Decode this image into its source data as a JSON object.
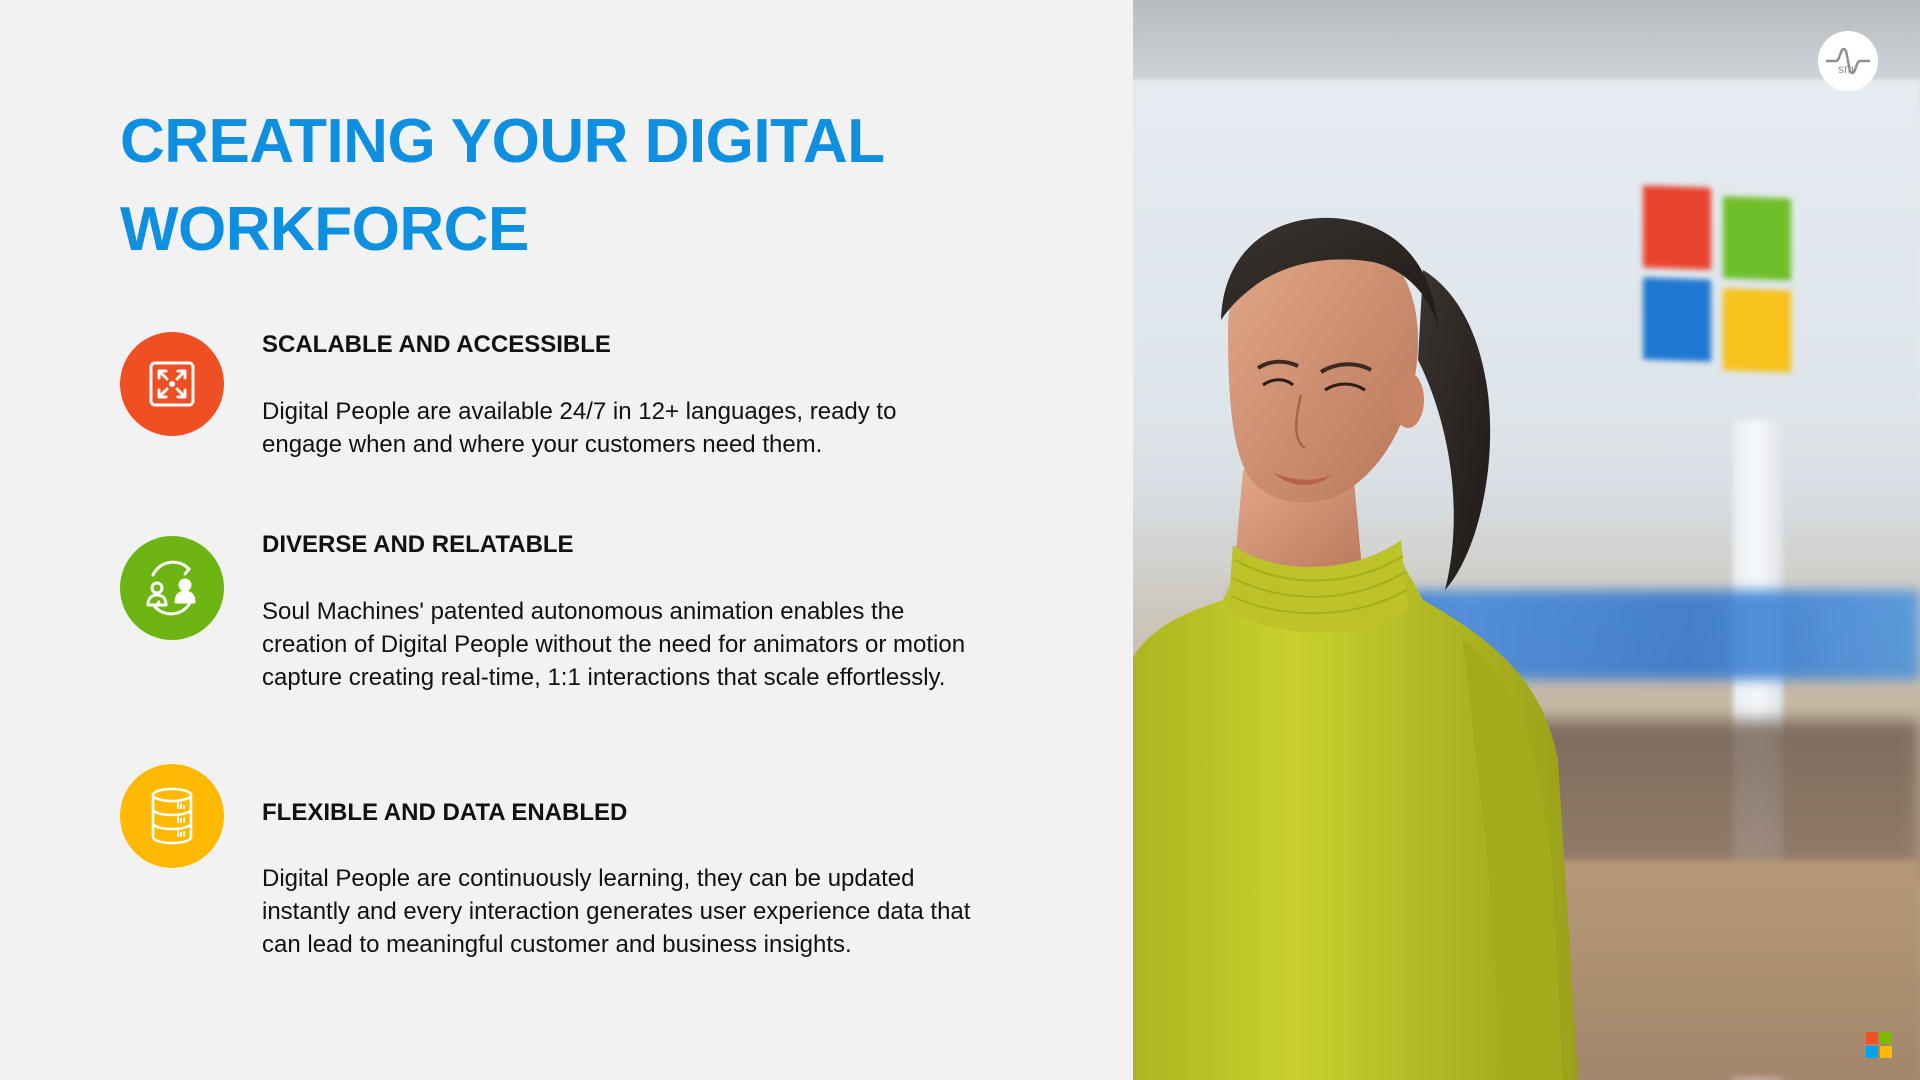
{
  "slide": {
    "title": "CREATING YOUR DIGITAL WORKFORCE",
    "features": [
      {
        "heading": "SCALABLE AND ACCESSIBLE",
        "body": "Digital People are available 24/7 in 12+ languages, ready to engage when and where your customers need them.",
        "icon": "expand-icon",
        "color": "#f04e23"
      },
      {
        "heading": "DIVERSE AND RELATABLE",
        "body": "Soul Machines' patented autonomous animation enables the creation of Digital People without the need for animators or motion capture creating real-time, 1:1 interactions that scale effortlessly.",
        "icon": "people-exchange-icon",
        "color": "#6db512"
      },
      {
        "heading": "FLEXIBLE AND DATA ENABLED",
        "body": "Digital People are continuously learning, they can be updated instantly and every interaction generates user experience data that can lead to meaningful customer and business insights.",
        "icon": "database-icon",
        "color": "#ffb900"
      }
    ]
  },
  "branding": {
    "soul_machines_logo_text": "sm",
    "microsoft_logo_colors": [
      "#f25022",
      "#7fba00",
      "#00a4ef",
      "#ffb900"
    ]
  },
  "colors": {
    "title": "#0f8fe0",
    "background": "#f2f2f2",
    "sweater": "#c5cc2c"
  }
}
